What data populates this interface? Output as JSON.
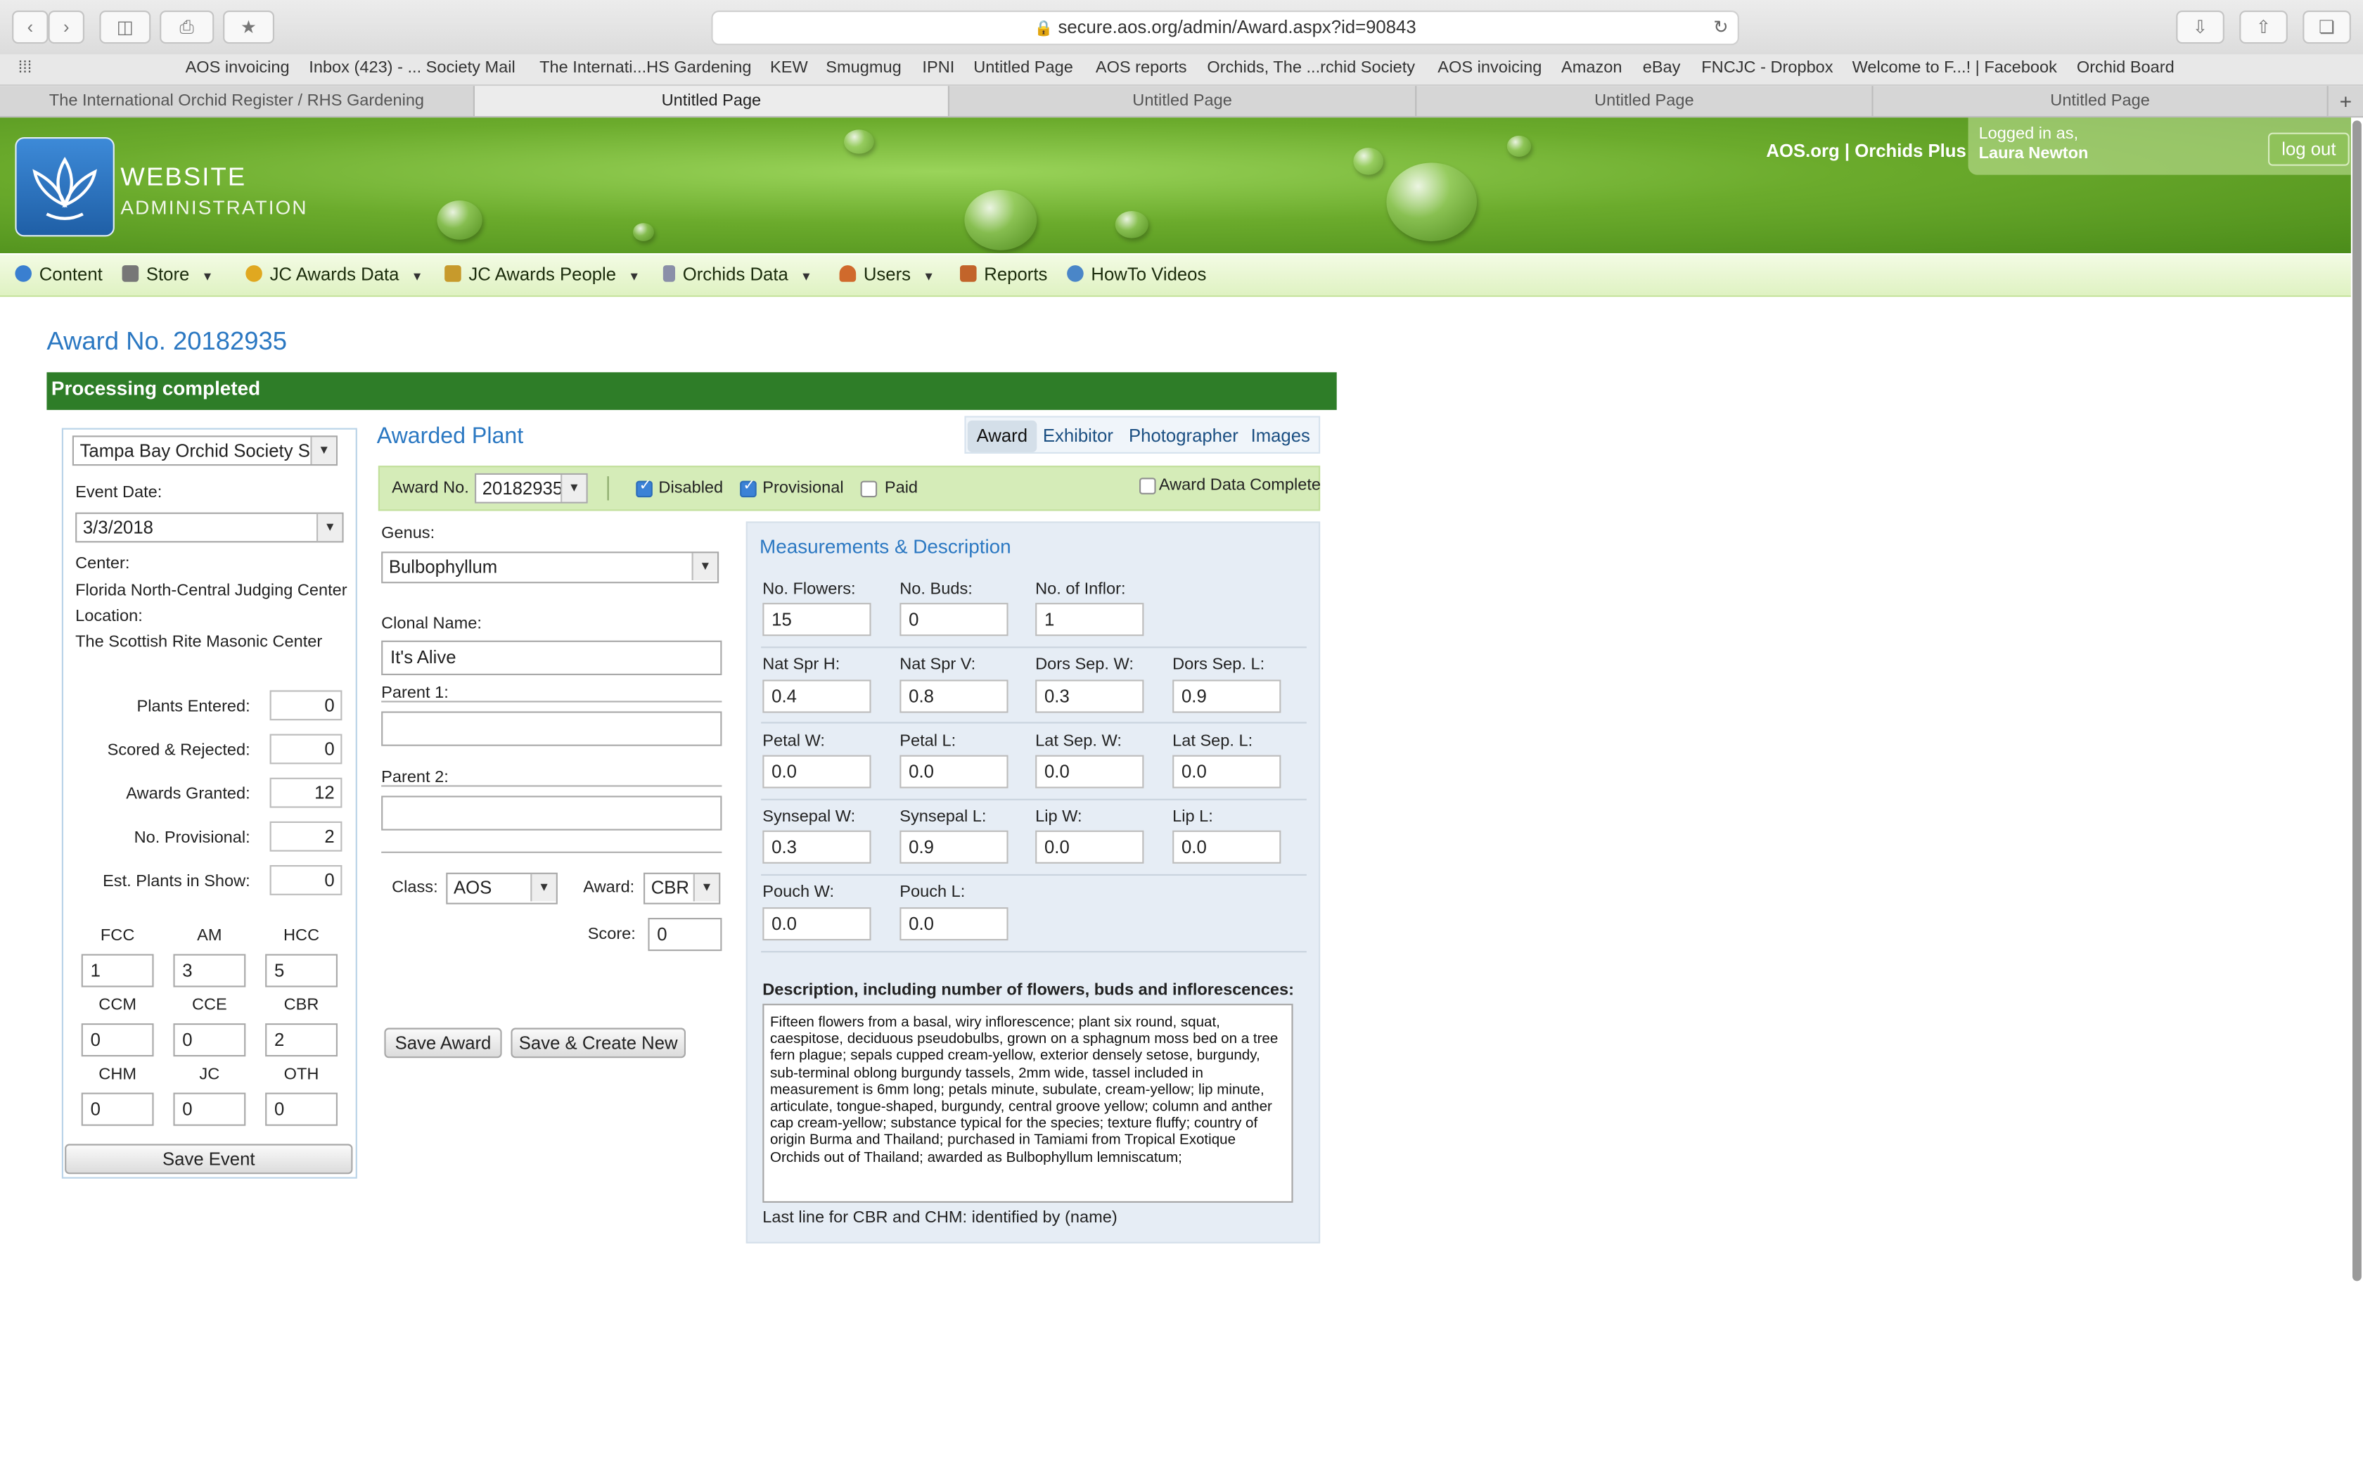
{
  "browser": {
    "url": "secure.aos.org/admin/Award.aspx?id=90843",
    "notification_count": "1",
    "bookmarks": [
      "AOS invoicing",
      "Inbox (423) - ... Society Mail",
      "The Internati...HS Gardening",
      "KEW",
      "Smugmug",
      "IPNI",
      "Untitled Page",
      "AOS reports",
      "Orchids, The ...rchid Society",
      "AOS invoicing",
      "Amazon",
      "eBay",
      "FNCJC - Dropbox",
      "Welcome to F...! | Facebook",
      "Orchid Board"
    ],
    "tabs": [
      "The International Orchid Register / RHS Gardening",
      "Untitled Page",
      "Untitled Page",
      "Untitled Page",
      "Untitled Page"
    ],
    "new_tab": "+"
  },
  "header": {
    "brand_line1": "WEBSITE",
    "brand_line2": "ADMINISTRATION",
    "links": "AOS.org | Orchids Plus",
    "logged_in_label": "Logged in as,",
    "user": "Laura Newton",
    "logout": "log out"
  },
  "nav": [
    {
      "label": "Content",
      "icon": "globe-icon",
      "color": "#3a7fd0"
    },
    {
      "label": "Store",
      "icon": "cart-icon",
      "color": "#777777"
    },
    {
      "label": "JC Awards Data",
      "icon": "medal-icon",
      "color": "#e0a820"
    },
    {
      "label": "JC Awards People",
      "icon": "ribbon-icon",
      "color": "#c79a2c"
    },
    {
      "label": "Orchids Data",
      "icon": "database-icon",
      "color": "#8a8fa8"
    },
    {
      "label": "Users",
      "icon": "user-icon",
      "color": "#d06a2c"
    },
    {
      "label": "Reports",
      "icon": "chart-icon",
      "color": "#c2642a"
    },
    {
      "label": "HowTo Videos",
      "icon": "video-icon",
      "color": "#4a86c8"
    }
  ],
  "page": {
    "title": "Award No. 20182935",
    "status": "Processing completed"
  },
  "event": {
    "show": "Tampa Bay Orchid Society Sho",
    "event_date_label": "Event Date:",
    "event_date": "3/3/2018",
    "center_label": "Center:",
    "center": "Florida North-Central Judging Center",
    "location_label": "Location:",
    "location": "The Scottish Rite Masonic Center",
    "stats": [
      {
        "label": "Plants Entered:",
        "value": "0"
      },
      {
        "label": "Scored & Rejected:",
        "value": "0"
      },
      {
        "label": "Awards Granted:",
        "value": "12"
      },
      {
        "label": "No. Provisional:",
        "value": "2"
      },
      {
        "label": "Est. Plants in Show:",
        "value": "0"
      }
    ],
    "counts": [
      {
        "label": "FCC",
        "value": "1"
      },
      {
        "label": "AM",
        "value": "3"
      },
      {
        "label": "HCC",
        "value": "5"
      },
      {
        "label": "CCM",
        "value": "0"
      },
      {
        "label": "CCE",
        "value": "0"
      },
      {
        "label": "CBR",
        "value": "2"
      },
      {
        "label": "CHM",
        "value": "0"
      },
      {
        "label": "JC",
        "value": "0"
      },
      {
        "label": "OTH",
        "value": "0"
      }
    ],
    "save_label": "Save Event"
  },
  "plant": {
    "heading": "Awarded Plant",
    "tabs": [
      "Award",
      "Exhibitor",
      "Photographer",
      "Images"
    ],
    "award_no_label": "Award No.",
    "award_no": "20182935",
    "disabled_label": "Disabled",
    "provisional_label": "Provisional",
    "paid_label": "Paid",
    "complete_label": "Award Data Complete",
    "genus_label": "Genus:",
    "genus": "Bulbophyllum",
    "clonal_label": "Clonal Name:",
    "clonal": "It's Alive",
    "parent1_label": "Parent 1:",
    "parent1": "",
    "parent2_label": "Parent 2:",
    "parent2": "",
    "class_label": "Class:",
    "class_value": "AOS",
    "award_label": "Award:",
    "award_value": "CBR",
    "score_label": "Score:",
    "score": "0",
    "save_award": "Save Award",
    "save_new": "Save & Create New"
  },
  "measure": {
    "heading": "Measurements & Description",
    "fields": [
      {
        "label": "No. Flowers:",
        "value": "15"
      },
      {
        "label": "No. Buds:",
        "value": "0"
      },
      {
        "label": "No. of Inflor:",
        "value": "1"
      },
      {
        "label": "Nat Spr H:",
        "value": "0.4"
      },
      {
        "label": "Nat Spr V:",
        "value": "0.8"
      },
      {
        "label": "Dors Sep. W:",
        "value": "0.3"
      },
      {
        "label": "Dors Sep. L:",
        "value": "0.9"
      },
      {
        "label": "Petal W:",
        "value": "0.0"
      },
      {
        "label": "Petal L:",
        "value": "0.0"
      },
      {
        "label": "Lat Sep. W:",
        "value": "0.0"
      },
      {
        "label": "Lat Sep. L:",
        "value": "0.0"
      },
      {
        "label": "Synsepal W:",
        "value": "0.3"
      },
      {
        "label": "Synsepal L:",
        "value": "0.9"
      },
      {
        "label": "Lip W:",
        "value": "0.0"
      },
      {
        "label": "Lip L:",
        "value": "0.0"
      },
      {
        "label": "Pouch W:",
        "value": "0.0"
      },
      {
        "label": "Pouch L:",
        "value": "0.0"
      }
    ],
    "desc_label": "Description, including number of flowers, buds and inflorescences:",
    "description": "Fifteen flowers from a basal, wiry inflorescence; plant six round, squat, caespitose, deciduous pseudobulbs, grown on a sphagnum moss bed on a tree fern plague; sepals cupped cream-yellow, exterior densely setose, burgundy, sub-terminal oblong burgundy tassels, 2mm wide, tassel included in measurement is 6mm long; petals minute, subulate, cream-yellow; lip minute, articulate, tongue-shaped, burgundy, central groove yellow; column and anther cap cream-yellow; substance typical for the species; texture fluffy; country of origin Burma and Thailand; purchased in Tamiami from Tropical Exotique Orchids out of Thailand; awarded as Bulbophyllum lemniscatum;",
    "note": "Last line for CBR and CHM: identified by (name)"
  }
}
